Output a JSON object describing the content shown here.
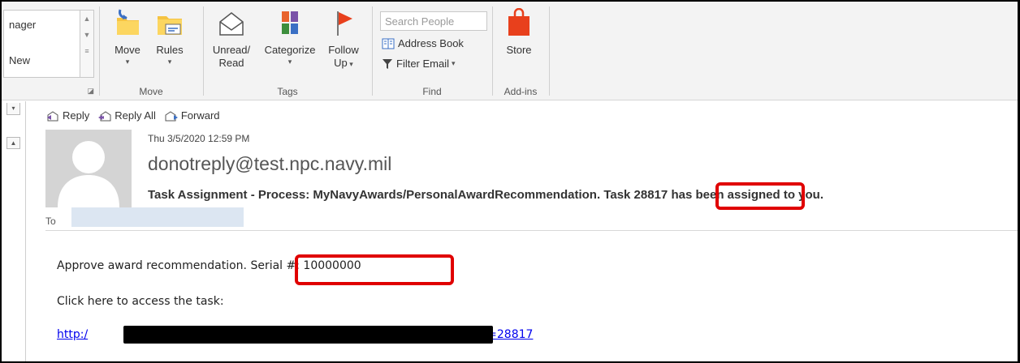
{
  "ribbon": {
    "quick_steps": {
      "item1": "nager",
      "item2": "New"
    },
    "move_group": {
      "move_label": "Move",
      "rules_label": "Rules",
      "group_label": "Move"
    },
    "tags_group": {
      "unread_label_1": "Unread/",
      "unread_label_2": "Read",
      "categorize_label": "Categorize",
      "follow_label_1": "Follow",
      "follow_label_2": "Up",
      "group_label": "Tags"
    },
    "find_group": {
      "search_placeholder": "Search People",
      "address_book_label": "Address Book",
      "filter_email_label": "Filter Email",
      "group_label": "Find"
    },
    "addins_group": {
      "store_label": "Store",
      "group_label": "Add-ins"
    }
  },
  "message": {
    "actions": {
      "reply": "Reply",
      "reply_all": "Reply All",
      "forward": "Forward"
    },
    "date": "Thu 3/5/2020 12:59 PM",
    "sender": "donotreply@test.npc.navy.mil",
    "subject_prefix": "Task Assignment - Process: MyNavyAwards/PersonalAwardRecommendation.",
    "subject_task": "Task 28817",
    "subject_suffix": "has been assigned to you.",
    "to_label": "To",
    "body_line1_prefix": "Approve award recommendation.",
    "body_line1_serial": "Serial #: 10000000",
    "body_line2": "Click here to access the task:",
    "link_start": "http:/",
    "link_end": "askId=28817"
  },
  "colors": {
    "highlight": "#e00000",
    "link": "#0000ee",
    "store_icon": "#e8401c",
    "follow_flag": "#e8401c"
  }
}
